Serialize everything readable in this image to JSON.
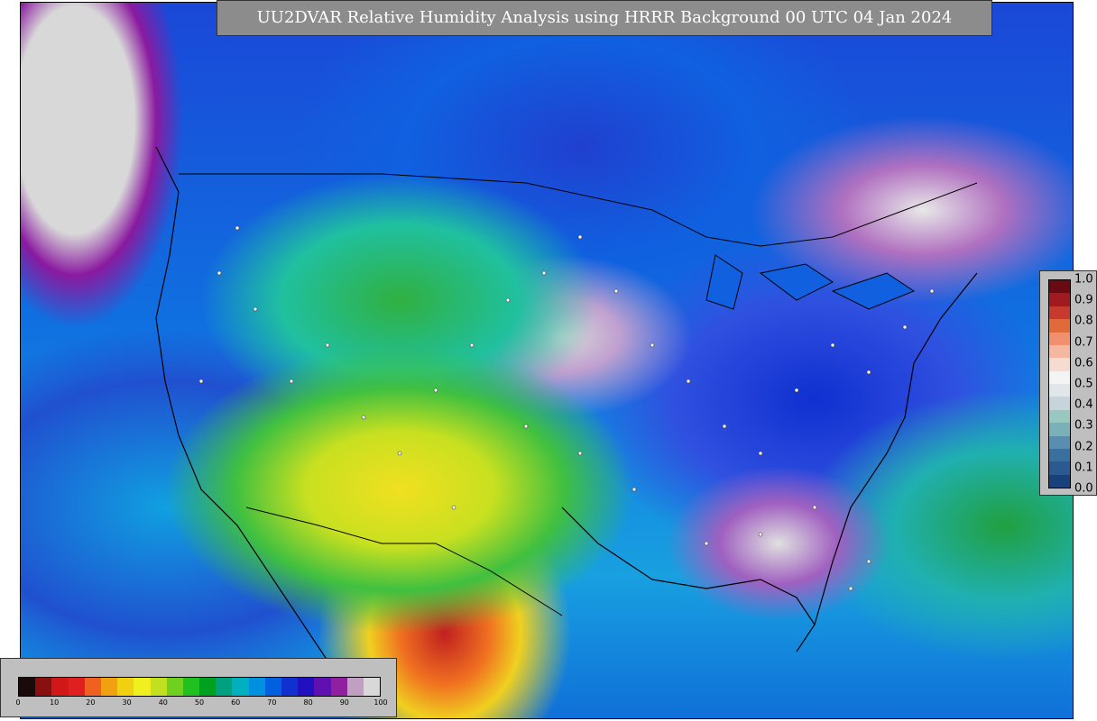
{
  "title": "UU2DVAR Relative Humidity Analysis using HRRR Background 00 UTC 04 Jan 2024",
  "map": {
    "description_icon": "contiguous-us-humidity-field",
    "colors": {
      "ocean_moist": "#1a48d8",
      "dry_yellow": "#f0e020",
      "very_dry_red": "#c02020",
      "saturated_gray": "#d8d8d8"
    }
  },
  "humidity_colorbar": {
    "tick_labels": [
      "0",
      "10",
      "20",
      "30",
      "40",
      "50",
      "60",
      "70",
      "80",
      "90",
      "100"
    ],
    "colors": [
      "#1a0a0a",
      "#8a1010",
      "#d01818",
      "#e02020",
      "#f06020",
      "#f0a010",
      "#f0d010",
      "#f0f020",
      "#c0e020",
      "#70d020",
      "#20c020",
      "#00a020",
      "#00a080",
      "#00b0c0",
      "#0090e0",
      "#0060e0",
      "#1030d0",
      "#2010c0",
      "#6010b0",
      "#9020a0",
      "#c0a0c0",
      "#d8d8d8"
    ]
  },
  "error_colorbar": {
    "tick_labels": [
      "1.0",
      "0.9",
      "0.8",
      "0.7",
      "0.6",
      "0.5",
      "0.4",
      "0.3",
      "0.2",
      "0.1",
      "0.0"
    ],
    "colors": [
      "#6a0a12",
      "#a01a20",
      "#c83a2e",
      "#e06a3a",
      "#f09070",
      "#f4b8a0",
      "#f6dcd0",
      "#f4f4f4",
      "#e0e6ea",
      "#c8d4dc",
      "#98c8c0",
      "#7ab0b8",
      "#5a8eb0",
      "#3a70a0",
      "#2a5a90",
      "#18407a"
    ]
  }
}
